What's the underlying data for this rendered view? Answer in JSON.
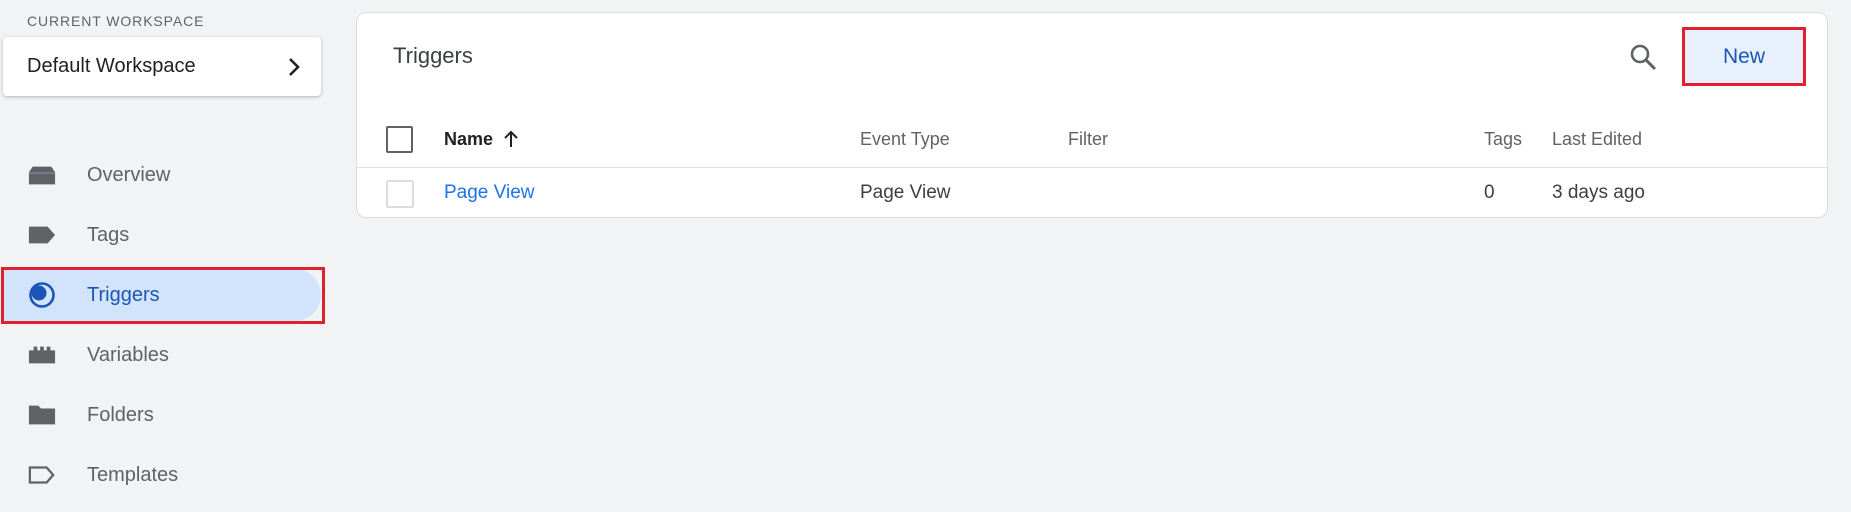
{
  "workspace": {
    "label": "CURRENT WORKSPACE",
    "name": "Default Workspace"
  },
  "nav": {
    "items": [
      {
        "label": "Overview",
        "icon": "overview-icon"
      },
      {
        "label": "Tags",
        "icon": "tag-icon"
      },
      {
        "label": "Triggers",
        "icon": "trigger-icon",
        "active": true
      },
      {
        "label": "Variables",
        "icon": "variables-icon"
      },
      {
        "label": "Folders",
        "icon": "folder-icon"
      },
      {
        "label": "Templates",
        "icon": "template-icon"
      }
    ]
  },
  "triggers": {
    "title": "Triggers",
    "new_label": "New",
    "columns": {
      "name": "Name",
      "event_type": "Event Type",
      "filter": "Filter",
      "tags": "Tags",
      "last_edited": "Last Edited"
    },
    "rows": [
      {
        "name": "Page View",
        "event_type": "Page View",
        "filter": "",
        "tags": "0",
        "last_edited": "3 days ago"
      }
    ]
  },
  "colors": {
    "accent": "#1a73e8",
    "active_bg": "#d2e3fc",
    "highlight": "#e0202c",
    "background": "#f1f3f4"
  }
}
